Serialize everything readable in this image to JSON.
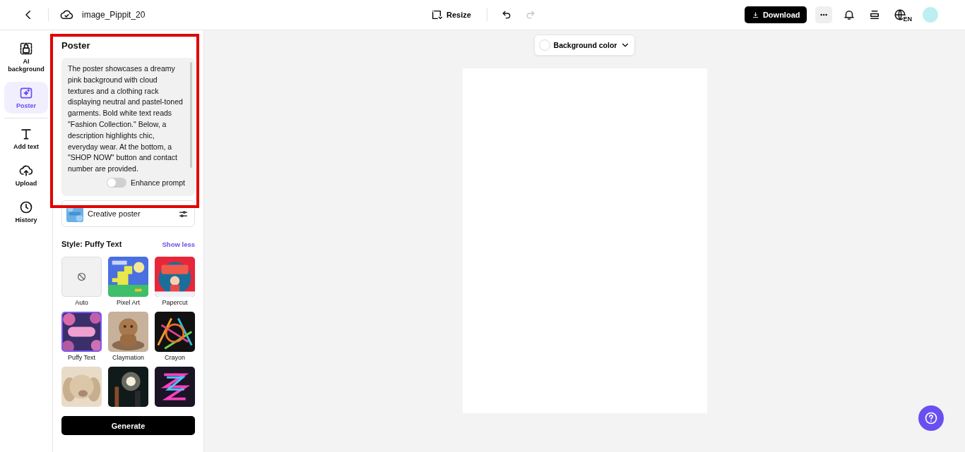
{
  "topbar": {
    "filename": "image_Pippit_20",
    "resize": "Resize",
    "redo_disabled": true,
    "download": "Download",
    "language": "EN"
  },
  "rail": [
    {
      "label": "AI background",
      "kind": "ai",
      "selected": false
    },
    {
      "label": "Poster",
      "kind": "poster",
      "selected": true
    },
    {
      "label": "Add text",
      "kind": "text",
      "selected": false
    },
    {
      "label": "Upload",
      "kind": "upload",
      "selected": false
    },
    {
      "label": "History",
      "kind": "history",
      "selected": false
    }
  ],
  "panel": {
    "title": "Poster",
    "prompt": "The poster showcases a dreamy pink background with cloud textures and a clothing rack displaying neutral and pastel-toned garments. Bold white text reads \"Fashion Collection.\" Below, a description highlights chic, everyday wear. At the bottom, a \"SHOP NOW\" button and contact number are provided.",
    "enhance": {
      "label": "Enhance prompt",
      "on": false
    },
    "mode": "Creative poster",
    "style_label": "Style: Puffy Text",
    "show_less": "Show less",
    "styles": [
      {
        "label": "Auto",
        "kind": "none",
        "selected": false
      },
      {
        "label": "Pixel Art",
        "kind": "pixel",
        "selected": false
      },
      {
        "label": "Papercut",
        "kind": "papercut",
        "selected": false
      },
      {
        "label": "Puffy Text",
        "kind": "puffy",
        "selected": true
      },
      {
        "label": "Claymation",
        "kind": "clay",
        "selected": false
      },
      {
        "label": "Crayon",
        "kind": "crayon",
        "selected": false
      },
      {
        "kind": "plush",
        "selected": false
      },
      {
        "kind": "film",
        "selected": false
      },
      {
        "kind": "neon",
        "selected": false
      }
    ],
    "generate": "Generate"
  },
  "canvas": {
    "background_button": "Background color"
  }
}
